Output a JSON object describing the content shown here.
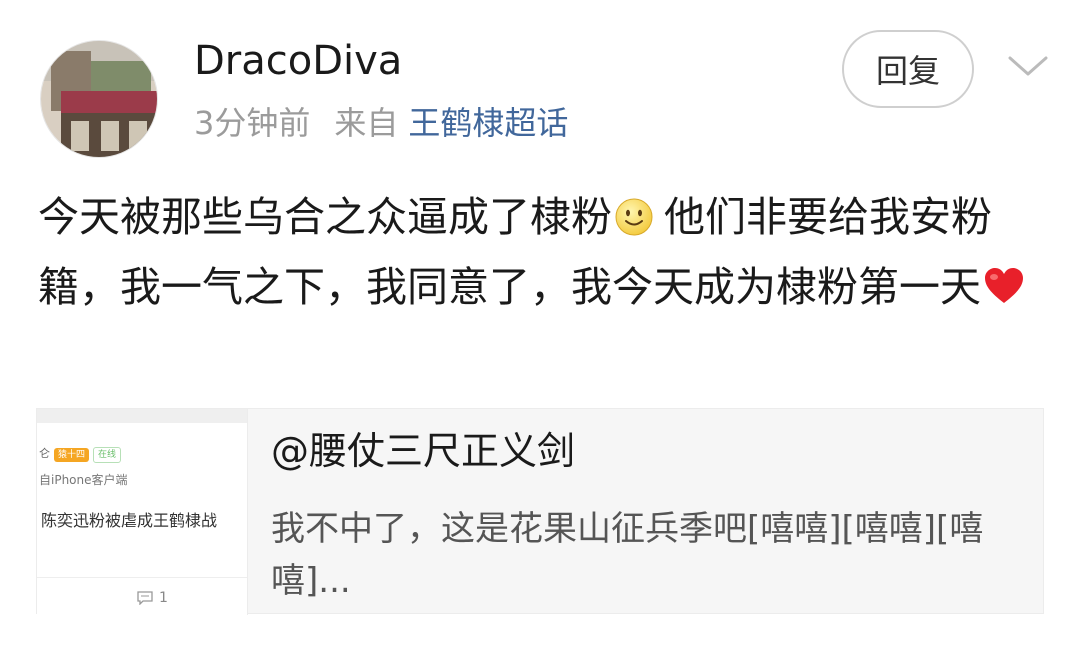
{
  "post": {
    "username": "DracoDiva",
    "time": "3分钟前",
    "from_label": "来自",
    "topic": "王鹤棣超话",
    "reply_label": "回复",
    "text_part1": "今天被那些乌合之众逼成了棣粉",
    "text_part2": "他们非要给我安粉籍，我一气之下，我同意了，我今天成为棣粉第一天",
    "emoji_1": "smile-emoji",
    "emoji_2": "red-heart-emoji"
  },
  "quote": {
    "author": "@腰仗三尺正义剑",
    "text": "我不中了，这是花果山征兵季吧[嘻嘻][嘻嘻][嘻嘻]...",
    "thumbnail": {
      "line1": "仑",
      "badge1": "猿十四",
      "badge2": "在线",
      "line2": "自iPhone客户端",
      "line3": "陈奕迅粉被虐成王鹤棣战",
      "comment_count": "1"
    }
  },
  "colors": {
    "link": "#41679b",
    "meta_gray": "#9b9b9b",
    "card_bg": "#f6f6f6"
  }
}
